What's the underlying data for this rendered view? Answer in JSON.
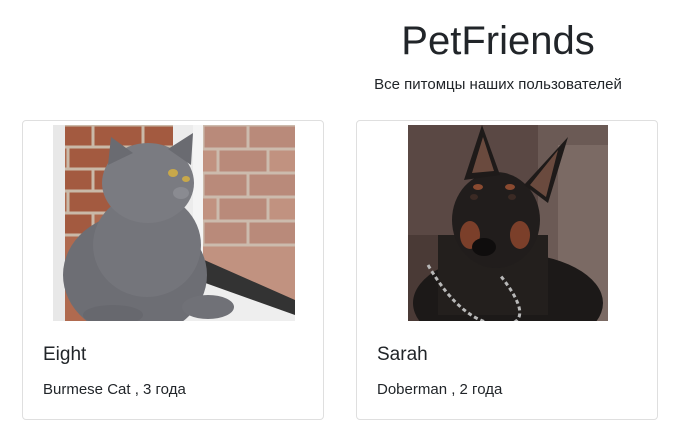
{
  "header": {
    "title": "PetFriends",
    "subtitle": "Все питомцы наших пользователей"
  },
  "pets": [
    {
      "name": "Eight",
      "breed": "Burmese Cat",
      "age": "3 года",
      "info": "Burmese Cat , 3 года",
      "photo_icon": "gray-cat-photo"
    },
    {
      "name": "Sarah",
      "breed": "Doberman",
      "age": "2 года",
      "info": "Doberman , 2 года",
      "photo_icon": "doberman-dog-photo"
    }
  ]
}
